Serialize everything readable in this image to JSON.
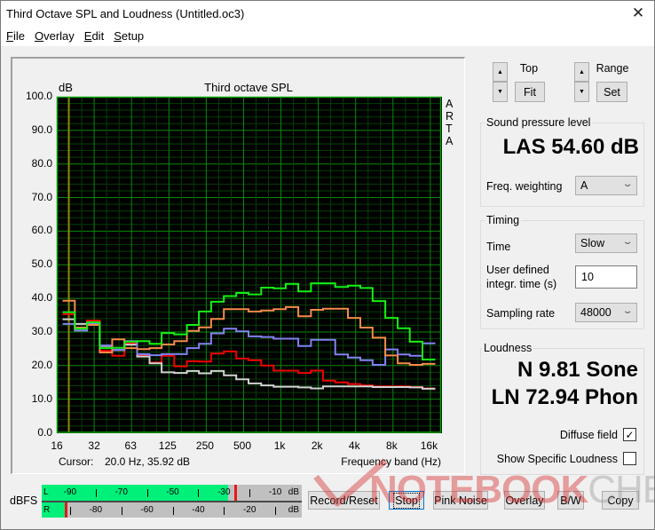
{
  "window": {
    "title": "Third Octave SPL and Loudness (Untitled.oc3)",
    "close_glyph": "✕"
  },
  "menu": [
    "File",
    "Overlay",
    "Edit",
    "Setup"
  ],
  "chart_data": {
    "type": "line",
    "style": "step",
    "title": "Third octave SPL",
    "ylabel": "dB",
    "xlabel": "Frequency band (Hz)",
    "side_label": "ARTA",
    "xscale": "log",
    "xlim": [
      16,
      20000
    ],
    "ylim": [
      0,
      100
    ],
    "grid": true,
    "y_ticks": [
      "100.0",
      "90.0",
      "80.0",
      "70.0",
      "60.0",
      "50.0",
      "40.0",
      "30.0",
      "20.0",
      "10.0",
      "0.0"
    ],
    "x_ticks": [
      {
        "value": 16,
        "label": "16"
      },
      {
        "value": 32,
        "label": "32"
      },
      {
        "value": 63,
        "label": "63"
      },
      {
        "value": 125,
        "label": "125"
      },
      {
        "value": 250,
        "label": "250"
      },
      {
        "value": 500,
        "label": "500"
      },
      {
        "value": 1000,
        "label": "1k"
      },
      {
        "value": 2000,
        "label": "2k"
      },
      {
        "value": 4000,
        "label": "4k"
      },
      {
        "value": 8000,
        "label": "8k"
      },
      {
        "value": 16000,
        "label": "16k"
      }
    ],
    "x": [
      20,
      25,
      31.5,
      40,
      50,
      63,
      80,
      100,
      125,
      160,
      200,
      250,
      315,
      400,
      500,
      630,
      800,
      1000,
      1250,
      1600,
      2000,
      2500,
      3150,
      4000,
      5000,
      6300,
      8000,
      10000,
      12500,
      16000
    ],
    "series": [
      {
        "name": "red",
        "color": "#f00000",
        "values": [
          35.3,
          31.0,
          33.4,
          24.4,
          22.9,
          26.6,
          23.1,
          20.9,
          22.9,
          19.8,
          21.3,
          21.2,
          23.6,
          24.2,
          22.1,
          21.6,
          20.0,
          18.5,
          18.5,
          17.8,
          18.5,
          15.5,
          15.0,
          14.5,
          14.1,
          13.8,
          13.8,
          13.8,
          13.6,
          13.2
        ]
      },
      {
        "name": "gray",
        "color": "#d2d2d2",
        "values": [
          33.8,
          32.4,
          32.6,
          25.8,
          24.6,
          26.2,
          22.7,
          20.7,
          18.0,
          17.8,
          18.4,
          17.7,
          18.4,
          17.1,
          15.9,
          14.7,
          14.1,
          13.7,
          13.7,
          13.5,
          13.2,
          13.8,
          13.8,
          13.8,
          13.8,
          13.6,
          13.6,
          13.6,
          13.5,
          13.1
        ]
      },
      {
        "name": "blue",
        "color": "#8282f2",
        "values": [
          32.4,
          30.4,
          32.6,
          26.0,
          24.7,
          27.3,
          23.4,
          23.1,
          23.4,
          23.4,
          25.2,
          26.5,
          29.6,
          31.0,
          30.2,
          28.7,
          28.5,
          28.0,
          28.0,
          25.8,
          27.7,
          27.7,
          23.3,
          22.4,
          21.6,
          20.2,
          24.8,
          23.3,
          22.9,
          26.6
        ]
      },
      {
        "name": "orange",
        "color": "#f58a4c",
        "values": [
          39.3,
          31.3,
          32.1,
          23.9,
          27.8,
          25.2,
          24.9,
          25.2,
          26.3,
          27.3,
          30.3,
          31.4,
          33.9,
          36.8,
          36.8,
          36.1,
          36.4,
          36.8,
          37.4,
          34.7,
          36.6,
          36.9,
          36.9,
          34.2,
          31.3,
          28.3,
          23.0,
          20.7,
          20.2,
          20.5
        ]
      },
      {
        "name": "green",
        "color": "#14f014",
        "values": [
          35.9,
          31.0,
          32.9,
          25.2,
          25.3,
          27.1,
          27.3,
          26.5,
          29.7,
          29.3,
          32.1,
          36.1,
          39.0,
          40.7,
          41.6,
          41.2,
          43.2,
          43.0,
          44.3,
          42.1,
          44.5,
          44.5,
          43.4,
          43.8,
          43.1,
          39.2,
          34.2,
          31.1,
          27.1,
          21.8
        ]
      }
    ],
    "cursor": {
      "freq": 20.0,
      "value": 35.92,
      "color": "#8c8c00"
    },
    "colors": {
      "background": "#000000",
      "grid_major": "#0a8a0a",
      "grid_minor": "#063f06",
      "border": "#00a000"
    }
  },
  "cursor_readout": {
    "label": "Cursor:",
    "value": "20.0 Hz, 35.92 dB"
  },
  "controls": {
    "top_label": "Top",
    "fit_label": "Fit",
    "range_label": "Range",
    "set_label": "Set",
    "up_glyph": "▲",
    "down_glyph": "▼"
  },
  "spl": {
    "title": "Sound pressure level",
    "value": "LAS 54.60 dB",
    "freq_weighting_label": "Freq. weighting",
    "freq_weighting": "A"
  },
  "timing": {
    "title": "Timing",
    "time_label": "Time",
    "time_value": "Slow",
    "integr_label_1": "User defined",
    "integr_label_2": "integr. time (s)",
    "integr_value": "10",
    "sampling_label": "Sampling rate",
    "sampling_value": "48000"
  },
  "loudness": {
    "title": "Loudness",
    "n_value": "N 9.81 Sone",
    "ln_value": "LN 72.94 Phon",
    "diffuse_label": "Diffuse field",
    "diffuse_checked": true,
    "specific_label": "Show Specific Loudness",
    "specific_checked": false
  },
  "meter": {
    "label": "dBFS",
    "range": [
      -100,
      0
    ],
    "unit": "dB",
    "left": {
      "name": "L",
      "level": -28.5,
      "peak": -25.6,
      "labels": [
        "-90",
        "-70",
        "-50",
        "-30",
        "-10"
      ],
      "ticks": [
        -80,
        -60,
        -40,
        -20
      ]
    },
    "right": {
      "name": "R",
      "level": -92.0,
      "peak": -91.7,
      "labels": [
        "-80",
        "-60",
        "-40",
        "-20"
      ],
      "ticks": [
        -90,
        -70,
        -50,
        -30,
        -10
      ]
    }
  },
  "buttons": {
    "record": "Record/Reset",
    "stop": "Stop",
    "pink": "Pink Noise",
    "overlay": "Overlay",
    "bw": "B/W",
    "copy": "Copy"
  },
  "watermark": {
    "part1": "NOTEBOOK",
    "part2": "CHECK"
  }
}
